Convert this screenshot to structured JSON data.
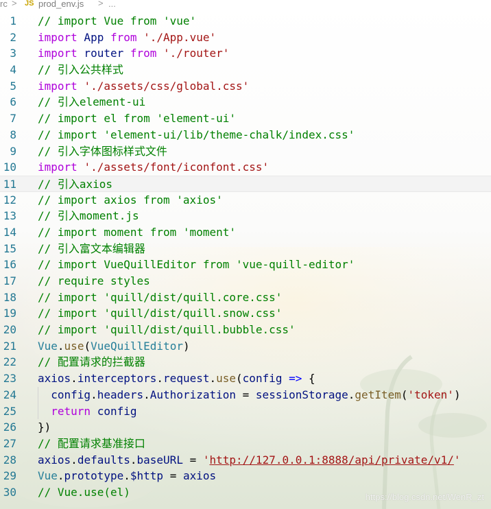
{
  "breadcrumb": {
    "folder": "rc",
    "separator": ">",
    "file_icon": "JS",
    "file": "prod_env.js",
    "more": "..."
  },
  "editor": {
    "active_line": 11,
    "lines": [
      {
        "n": "1",
        "tokens": [
          {
            "t": "// import Vue from 'vue'",
            "c": "comment"
          }
        ]
      },
      {
        "n": "2",
        "tokens": [
          {
            "t": "import",
            "c": "kw"
          },
          {
            "t": " App ",
            "c": "plain"
          },
          {
            "t": "from",
            "c": "kw"
          },
          {
            "t": " ",
            "c": "punct"
          },
          {
            "t": "'./App.vue'",
            "c": "str"
          }
        ]
      },
      {
        "n": "3",
        "tokens": [
          {
            "t": "import",
            "c": "kw"
          },
          {
            "t": " router ",
            "c": "plain"
          },
          {
            "t": "from",
            "c": "kw"
          },
          {
            "t": " ",
            "c": "punct"
          },
          {
            "t": "'./router'",
            "c": "str"
          }
        ]
      },
      {
        "n": "4",
        "tokens": [
          {
            "t": "// 引入公共样式",
            "c": "comment"
          }
        ]
      },
      {
        "n": "5",
        "tokens": [
          {
            "t": "import",
            "c": "kw"
          },
          {
            "t": " ",
            "c": "punct"
          },
          {
            "t": "'./assets/css/global.css'",
            "c": "str"
          }
        ]
      },
      {
        "n": "6",
        "tokens": [
          {
            "t": "// 引入element-ui",
            "c": "comment"
          }
        ]
      },
      {
        "n": "7",
        "tokens": [
          {
            "t": "// import el from 'element-ui'",
            "c": "comment"
          }
        ]
      },
      {
        "n": "8",
        "tokens": [
          {
            "t": "// import 'element-ui/lib/theme-chalk/index.css'",
            "c": "comment"
          }
        ]
      },
      {
        "n": "9",
        "tokens": [
          {
            "t": "// 引入字体图标样式文件",
            "c": "comment"
          }
        ]
      },
      {
        "n": "10",
        "tokens": [
          {
            "t": "import",
            "c": "kw"
          },
          {
            "t": " ",
            "c": "punct"
          },
          {
            "t": "'./assets/font/iconfont.css'",
            "c": "str"
          }
        ]
      },
      {
        "n": "11",
        "tokens": [
          {
            "t": "// 引入axios",
            "c": "comment"
          }
        ]
      },
      {
        "n": "12",
        "tokens": [
          {
            "t": "// import axios from 'axios'",
            "c": "comment"
          }
        ]
      },
      {
        "n": "13",
        "tokens": [
          {
            "t": "// 引入moment.js",
            "c": "comment"
          }
        ]
      },
      {
        "n": "14",
        "tokens": [
          {
            "t": "// import moment from 'moment'",
            "c": "comment"
          }
        ]
      },
      {
        "n": "15",
        "tokens": [
          {
            "t": "// 引入富文本编辑器",
            "c": "comment"
          }
        ]
      },
      {
        "n": "16",
        "tokens": [
          {
            "t": "// import VueQuillEditor from 'vue-quill-editor'",
            "c": "comment"
          }
        ]
      },
      {
        "n": "17",
        "tokens": [
          {
            "t": "// require styles",
            "c": "comment"
          }
        ]
      },
      {
        "n": "18",
        "tokens": [
          {
            "t": "// import 'quill/dist/quill.core.css'",
            "c": "comment"
          }
        ]
      },
      {
        "n": "19",
        "tokens": [
          {
            "t": "// import 'quill/dist/quill.snow.css'",
            "c": "comment"
          }
        ]
      },
      {
        "n": "20",
        "tokens": [
          {
            "t": "// import 'quill/dist/quill.bubble.css'",
            "c": "comment"
          }
        ]
      },
      {
        "n": "21",
        "tokens": [
          {
            "t": "Vue",
            "c": "type"
          },
          {
            "t": ".",
            "c": "punct"
          },
          {
            "t": "use",
            "c": "fn"
          },
          {
            "t": "(",
            "c": "punct"
          },
          {
            "t": "VueQuillEditor",
            "c": "type"
          },
          {
            "t": ")",
            "c": "punct"
          }
        ]
      },
      {
        "n": "22",
        "tokens": [
          {
            "t": "// 配置请求的拦截器",
            "c": "comment"
          }
        ]
      },
      {
        "n": "23",
        "tokens": [
          {
            "t": "axios",
            "c": "ident"
          },
          {
            "t": ".",
            "c": "punct"
          },
          {
            "t": "interceptors",
            "c": "ident"
          },
          {
            "t": ".",
            "c": "punct"
          },
          {
            "t": "request",
            "c": "ident"
          },
          {
            "t": ".",
            "c": "punct"
          },
          {
            "t": "use",
            "c": "fn"
          },
          {
            "t": "(",
            "c": "punct"
          },
          {
            "t": "config",
            "c": "ident"
          },
          {
            "t": " ",
            "c": "punct"
          },
          {
            "t": "=>",
            "c": "kw2"
          },
          {
            "t": " {",
            "c": "punct"
          }
        ]
      },
      {
        "n": "24",
        "indent": true,
        "tokens": [
          {
            "t": "  config",
            "c": "ident"
          },
          {
            "t": ".",
            "c": "punct"
          },
          {
            "t": "headers",
            "c": "ident"
          },
          {
            "t": ".",
            "c": "punct"
          },
          {
            "t": "Authorization",
            "c": "ident"
          },
          {
            "t": " = ",
            "c": "punct"
          },
          {
            "t": "sessionStorage",
            "c": "ident"
          },
          {
            "t": ".",
            "c": "punct"
          },
          {
            "t": "getItem",
            "c": "fn"
          },
          {
            "t": "(",
            "c": "punct"
          },
          {
            "t": "'token'",
            "c": "str"
          },
          {
            "t": ")",
            "c": "punct"
          }
        ]
      },
      {
        "n": "25",
        "indent": true,
        "tokens": [
          {
            "t": "  return",
            "c": "kw"
          },
          {
            "t": " config",
            "c": "ident"
          }
        ]
      },
      {
        "n": "26",
        "tokens": [
          {
            "t": "})",
            "c": "punct"
          }
        ]
      },
      {
        "n": "27",
        "tokens": [
          {
            "t": "// 配置请求基准接口",
            "c": "comment"
          }
        ]
      },
      {
        "n": "28",
        "tokens": [
          {
            "t": "axios",
            "c": "ident"
          },
          {
            "t": ".",
            "c": "punct"
          },
          {
            "t": "defaults",
            "c": "ident"
          },
          {
            "t": ".",
            "c": "punct"
          },
          {
            "t": "baseURL",
            "c": "ident"
          },
          {
            "t": " = ",
            "c": "punct"
          },
          {
            "t": "'",
            "c": "str"
          },
          {
            "t": "http://127.0.0.1:8888/api/private/v1/",
            "c": "link"
          },
          {
            "t": "'",
            "c": "str"
          }
        ]
      },
      {
        "n": "29",
        "tokens": [
          {
            "t": "Vue",
            "c": "type"
          },
          {
            "t": ".",
            "c": "punct"
          },
          {
            "t": "prototype",
            "c": "ident"
          },
          {
            "t": ".",
            "c": "punct"
          },
          {
            "t": "$http",
            "c": "ident"
          },
          {
            "t": " = ",
            "c": "punct"
          },
          {
            "t": "axios",
            "c": "ident"
          }
        ]
      },
      {
        "n": "30",
        "tokens": [
          {
            "t": "// Vue.use(el)",
            "c": "comment"
          }
        ]
      }
    ]
  },
  "watermark": "https://blog.csdn.net/WenR_zt",
  "colors": {
    "comment": "#008000",
    "keyword": "#af00db",
    "string": "#a31515",
    "line_number": "#237893"
  }
}
